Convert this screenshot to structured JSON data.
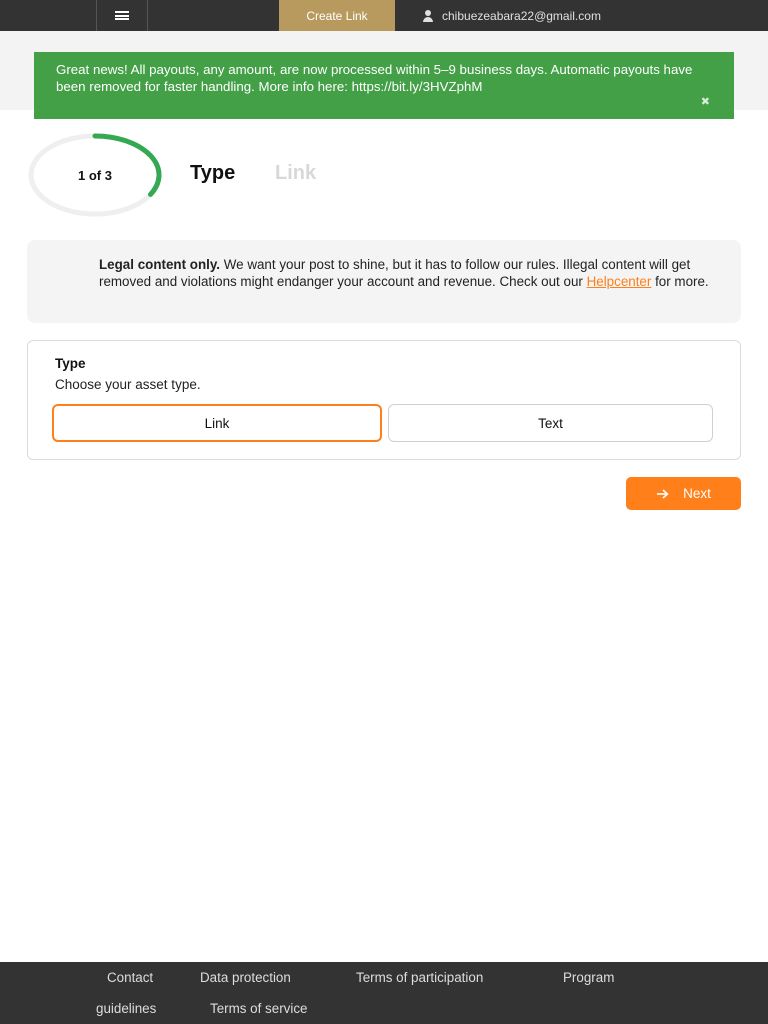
{
  "topbar": {
    "menu_icon": "hamburger-menu-icon",
    "create_link_label": "Create Link",
    "user_icon": "user-icon",
    "user_email": "chibuezeabara22@gmail.com",
    "colors": {
      "bar": "#333333",
      "create_link_bg": "#b89a5e"
    }
  },
  "banner": {
    "text": "Great news! All payouts, any amount, are now processed within 5–9 business days. Automatic payouts have been removed for faster handling. More info here: https://bit.ly/3HVZphM",
    "close_glyph": "✖",
    "color": "#43a047"
  },
  "stepper": {
    "progress_label": "1 of 3",
    "progress_fraction": 0.333,
    "current_step": "Type",
    "next_step": "Link",
    "accent": "#34a852"
  },
  "notice": {
    "icon": "lightbulb-icon",
    "bold": "Legal content only.",
    "text": " We want your post to shine, but it has to follow our rules. Illegal content will get removed and violations might endanger your account and revenue. Check out our ",
    "link_label": "Helpcenter",
    "suffix": " for more."
  },
  "type_card": {
    "title": "Type",
    "subtitle": "Choose your asset type.",
    "options": [
      {
        "label": "Link",
        "selected": true
      },
      {
        "label": "Text",
        "selected": false
      }
    ]
  },
  "next_button": {
    "label": "Next",
    "icon": "arrow-right-icon",
    "color": "#ff7f1a"
  },
  "footer": {
    "links": [
      "Contact",
      "Data protection",
      "Terms of participation",
      "Program",
      "guidelines",
      "Terms of service"
    ]
  }
}
